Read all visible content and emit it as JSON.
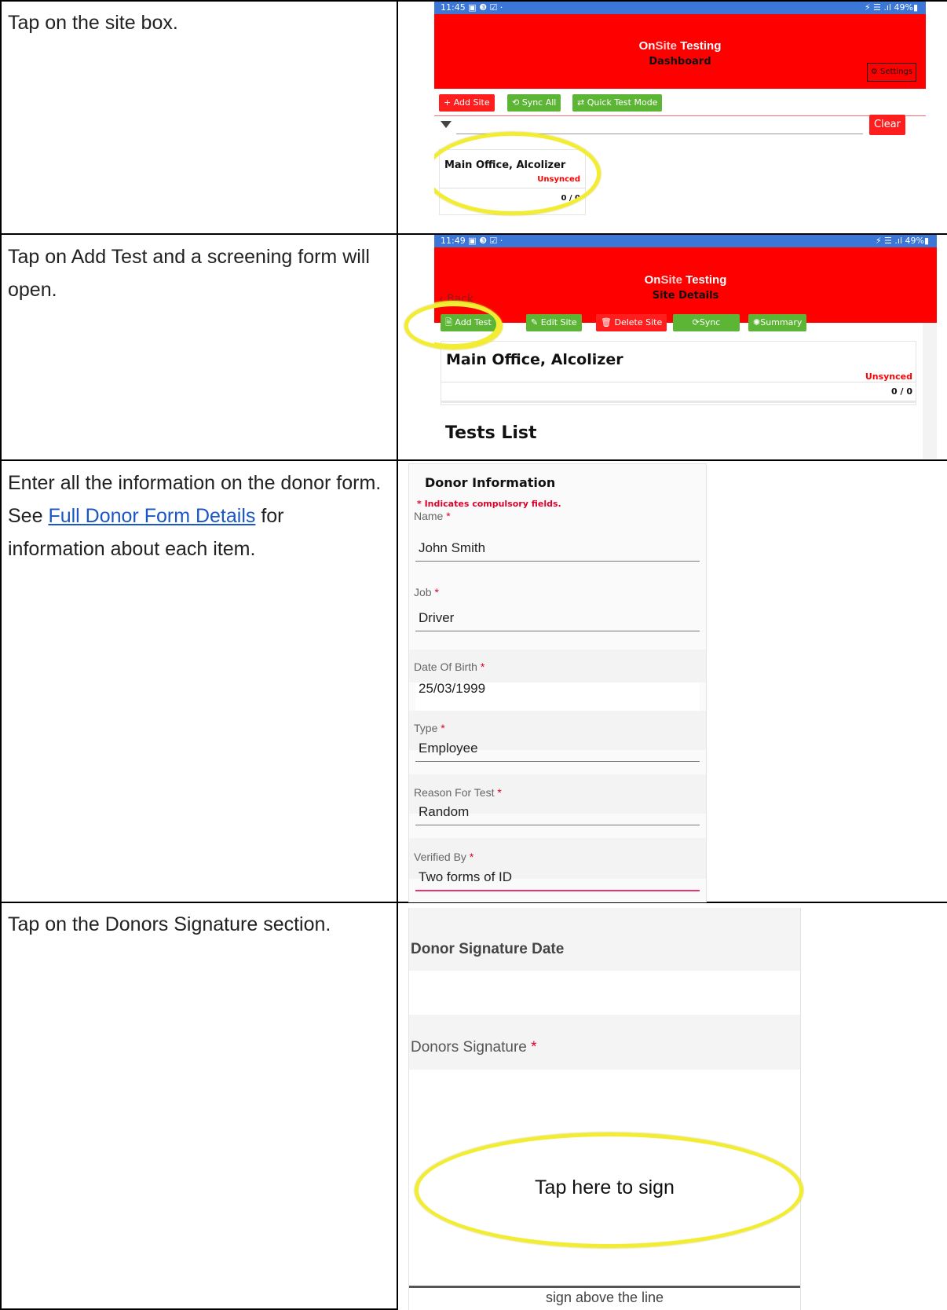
{
  "instructions": [
    "Tap on the site box.",
    "Tap on Add Test and a screening form will open.",
    "Enter all the information on the donor form. See ",
    "Full Donor Form Details",
    " for information about each item.",
    "Tap on the Donors Signature section."
  ],
  "app": {
    "brand_on": "On",
    "brand_site": "Site",
    "brand_testing": "Testing",
    "status_right": "⚡ ☰ .ıl 49%▮"
  },
  "screen1": {
    "time": "11:45 ▣ ❸ ☑ ·",
    "title": "Dashboard",
    "settings": "Settings",
    "add_site": "+ Add Site",
    "sync_all": "⟲ Sync All",
    "quick_test": "⇄ Quick Test Mode",
    "clear": "Clear",
    "site_name": "Main Office, Alcolizer",
    "site_status": "Unsynced",
    "site_count": "0 / 0"
  },
  "screen2": {
    "time": "11:49 ▣ ❸ ☑ ·",
    "back": "‹ Back",
    "title": "Site Details",
    "add_test": "Add Test",
    "edit_site": "Edit Site",
    "delete_site": "Delete Site",
    "sync": "Sync",
    "summary": "Summary",
    "site_name": "Main Office, Alcolizer",
    "site_status": "Unsynced",
    "site_count": "0 / 0",
    "tests_list": "Tests List"
  },
  "screen3": {
    "heading": "Donor Information",
    "compulsory": "* Indicates compulsory fields.",
    "fields": [
      {
        "label": "Name",
        "value": "John Smith"
      },
      {
        "label": "Job",
        "value": "Driver"
      },
      {
        "label": "Date Of Birth",
        "value": "25/03/1999"
      },
      {
        "label": "Type",
        "value": "Employee"
      },
      {
        "label": "Reason For Test",
        "value": "Random"
      },
      {
        "label": "Verified By",
        "value": "Two forms of ID"
      }
    ]
  },
  "screen4": {
    "sig_date": "Donor Signature Date",
    "sig_label": "Donors Signature",
    "tap_here": "Tap here to sign",
    "sign_line": "sign above the line"
  },
  "colors": {
    "accent_red": "#ff0000",
    "button_green": "#5cb534",
    "highlight_yellow": "#f2ec32",
    "status_blue": "#3c77d8"
  }
}
